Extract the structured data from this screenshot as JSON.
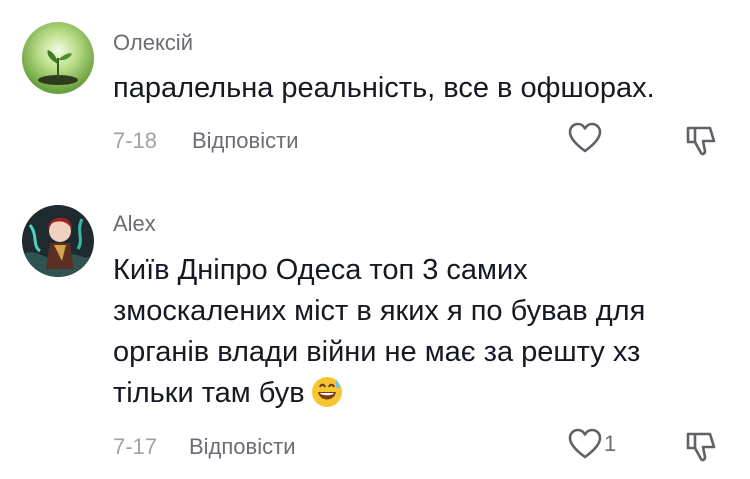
{
  "comments": [
    {
      "author": "Олексій",
      "text": "паралельна реальність, все в офшорах.",
      "date": "7-18",
      "reply_label": "Відповісти",
      "like_count": "",
      "avatar_icon": "sprout-avatar",
      "accent": "#8ec45c"
    },
    {
      "author": "Alex",
      "text": "Київ Дніпро Одеса топ 3 самих змоскалених міст в яких я по бував для органів влади війни не має за решту хз тільки там був",
      "date": "7-17",
      "reply_label": "Відповісти",
      "like_count": "1",
      "avatar_icon": "anime-character-avatar",
      "emoji_icon": "grinning-sweat-emoji"
    }
  ]
}
